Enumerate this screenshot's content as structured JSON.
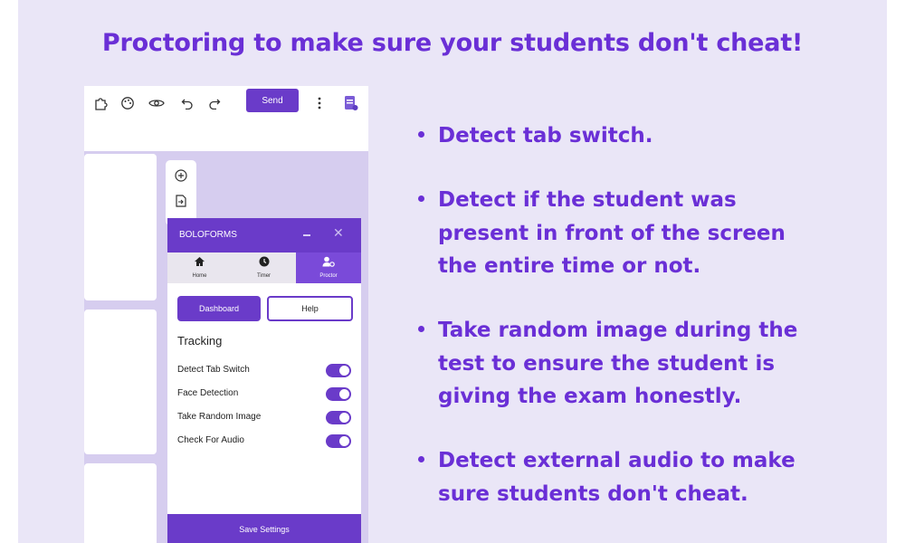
{
  "headline": "Proctoring to make sure your students don't cheat!",
  "toolbar": {
    "icons": [
      "puzzle-icon",
      "palette-icon",
      "eye-icon",
      "undo-icon",
      "redo-icon",
      "more-icon",
      "form-icon"
    ],
    "send_label": "Send"
  },
  "side_tools": [
    "add-circle-icon",
    "import-icon"
  ],
  "panel": {
    "title": "BOLOFORMS",
    "tabs": [
      {
        "label": "Home",
        "icon": "home-icon"
      },
      {
        "label": "Timer",
        "icon": "clock-icon"
      },
      {
        "label": "Proctor",
        "icon": "user-settings-icon"
      }
    ],
    "dashboard_label": "Dashboard",
    "help_label": "Help",
    "tracking_title": "Tracking",
    "toggles": [
      {
        "label": "Detect Tab Switch",
        "on": true
      },
      {
        "label": "Face Detection",
        "on": true
      },
      {
        "label": "Take Random Image",
        "on": true
      },
      {
        "label": "Check For Audio",
        "on": true
      }
    ],
    "save_label": "Save Settings"
  },
  "bullets": [
    {
      "lines": [
        "Detect tab switch."
      ]
    },
    {
      "lines": [
        "Detect if the student was",
        "present in front of the screen",
        "the entire time or not."
      ]
    },
    {
      "lines": [
        "Take random image during the",
        "test to ensure the student is",
        "giving the exam honestly."
      ]
    },
    {
      "lines": [
        "Detect external audio to make",
        "sure students don't cheat."
      ]
    }
  ],
  "colors": {
    "accent": "#6a2fd6",
    "panel_purple": "#6a3bc9",
    "background": "#eae6f7"
  }
}
